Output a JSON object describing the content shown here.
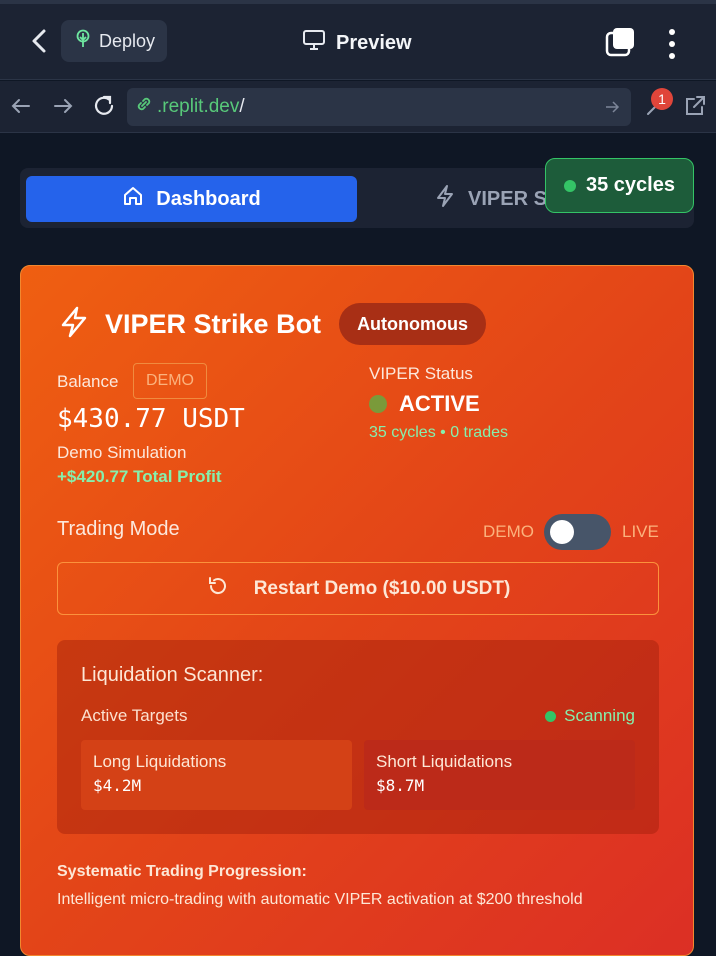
{
  "browser": {
    "deploy_label": "Deploy",
    "preview_label": "Preview",
    "url_host": ".replit.dev",
    "url_path": "/",
    "notification_count": "1"
  },
  "tabs": {
    "dashboard_label": "Dashboard",
    "viper_label": "VIPER S"
  },
  "cycles_badge": "35 cycles",
  "bot": {
    "title": "VIPER Strike Bot",
    "mode_pill": "Autonomous",
    "balance_label": "Balance",
    "balance_tag": "DEMO",
    "balance_value": "$430.77 USDT",
    "balance_sub": "Demo Simulation",
    "profit": "+$420.77 Total Profit",
    "status_label": "VIPER Status",
    "status_value": "ACTIVE",
    "status_meta": "35 cycles • 0 trades",
    "trading_mode_label": "Trading Mode",
    "toggle_left": "DEMO",
    "toggle_right": "LIVE",
    "toggle_state": "demo",
    "restart_label": "Restart Demo ($10.00 USDT)"
  },
  "scanner": {
    "title": "Liquidation Scanner:",
    "subtitle": "Active Targets",
    "state": "Scanning",
    "long_label": "Long Liquidations",
    "long_value": "$4.2M",
    "short_label": "Short Liquidations",
    "short_value": "$8.7M"
  },
  "progression": {
    "title": "Systematic Trading Progression:",
    "description": "Intelligent micro-trading with automatic VIPER activation at $200 threshold"
  },
  "colors": {
    "accent_blue": "#2563eb",
    "card_orange": "#e34518",
    "success_green": "#86efac",
    "status_olive": "#7a9a3a"
  }
}
